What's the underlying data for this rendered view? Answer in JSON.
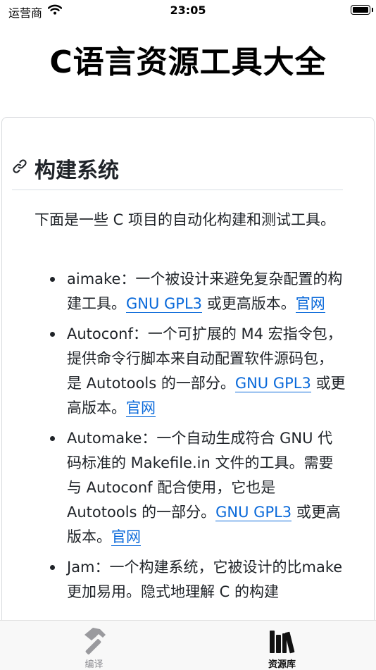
{
  "status_bar": {
    "carrier": "运营商",
    "time": "23:05"
  },
  "app_title": "C语言资源工具大全",
  "section": {
    "heading": "构建系统",
    "intro": "下面是一些 C 项目的自动化构建和测试工具。",
    "items": [
      {
        "name": "aimake",
        "text": "：一个被设计来避免复杂配置的构建工具。",
        "license_link": "GNU GPL3",
        "license_suffix": " 或更高版本。",
        "site_link": "官网"
      },
      {
        "name": "Autoconf",
        "text": "：一个可扩展的 M4 宏指令包，提供命令行脚本来自动配置软件源码包，是 Autotools 的一部分。",
        "license_link": "GNU GPL3",
        "license_suffix": " 或更高版本。",
        "site_link": "官网"
      },
      {
        "name": "Automake",
        "text": "：一个自动生成符合 GNU 代码标准的 Makefile.in 文件的工具。需要与 Autoconf 配合使用，它也是 Autotools 的一部分。",
        "license_link": "GNU GPL3",
        "license_suffix": " 或更高版本。",
        "site_link": "官网"
      },
      {
        "name": "Jam",
        "text": "：一个构建系统，它被设计的比make更加易用。隐式地理解 C 的构建"
      }
    ]
  },
  "tab_bar": {
    "tabs": [
      {
        "label": "编译",
        "icon": "hammer-icon",
        "selected": false
      },
      {
        "label": "资源库",
        "icon": "books-icon",
        "selected": true
      }
    ]
  },
  "colors": {
    "link": "#0969da",
    "text": "#1f2328",
    "tab_inactive": "#8e8e93"
  }
}
